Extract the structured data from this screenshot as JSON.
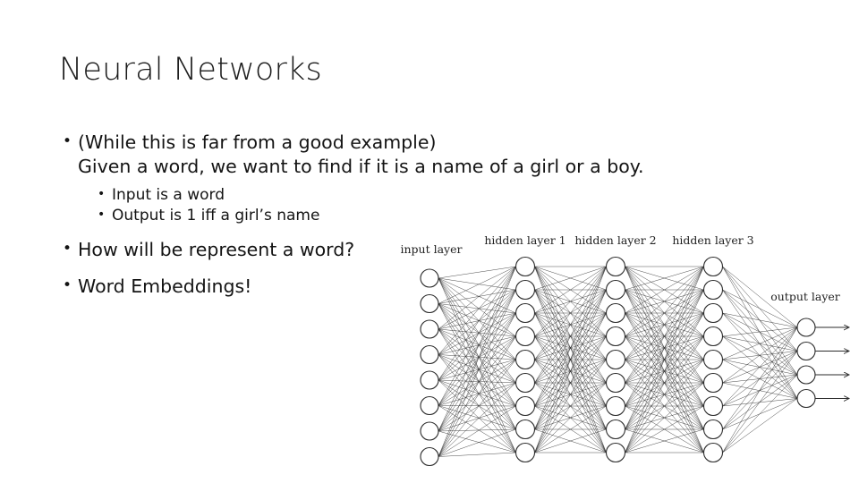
{
  "slide": {
    "title": "Neural Networks",
    "bullets": [
      {
        "level": 1,
        "marker": "•",
        "line1": "(While this is far from a good example)",
        "line2": "Given a word, we want to find if it is a name of a girl or a boy."
      },
      {
        "level": 2,
        "marker": "•",
        "line1": "Input is a word"
      },
      {
        "level": 2,
        "marker": "•",
        "line1": "Output is 1 iff a girl’s name"
      },
      {
        "level": 1,
        "marker": "•",
        "line1": "How will be represent a word?"
      },
      {
        "level": 1,
        "marker": "•",
        "line1": "Word Embeddings!"
      }
    ]
  },
  "diagram": {
    "name": "neural-network-architecture",
    "stroke_color": "#2b2b2b",
    "node_fill": "#ffffff",
    "labels": {
      "input": "input layer",
      "hidden1": "hidden layer 1",
      "hidden2": "hidden layer 2",
      "hidden3": "hidden layer 3",
      "output": "output layer"
    },
    "layers": [
      {
        "id": "input",
        "label": "input layer",
        "node_count": 8
      },
      {
        "id": "hidden1",
        "label": "hidden layer 1",
        "node_count": 9
      },
      {
        "id": "hidden2",
        "label": "hidden layer 2",
        "node_count": 9
      },
      {
        "id": "hidden3",
        "label": "hidden layer 3",
        "node_count": 9
      },
      {
        "id": "output",
        "label": "output layer",
        "node_count": 4
      }
    ]
  }
}
